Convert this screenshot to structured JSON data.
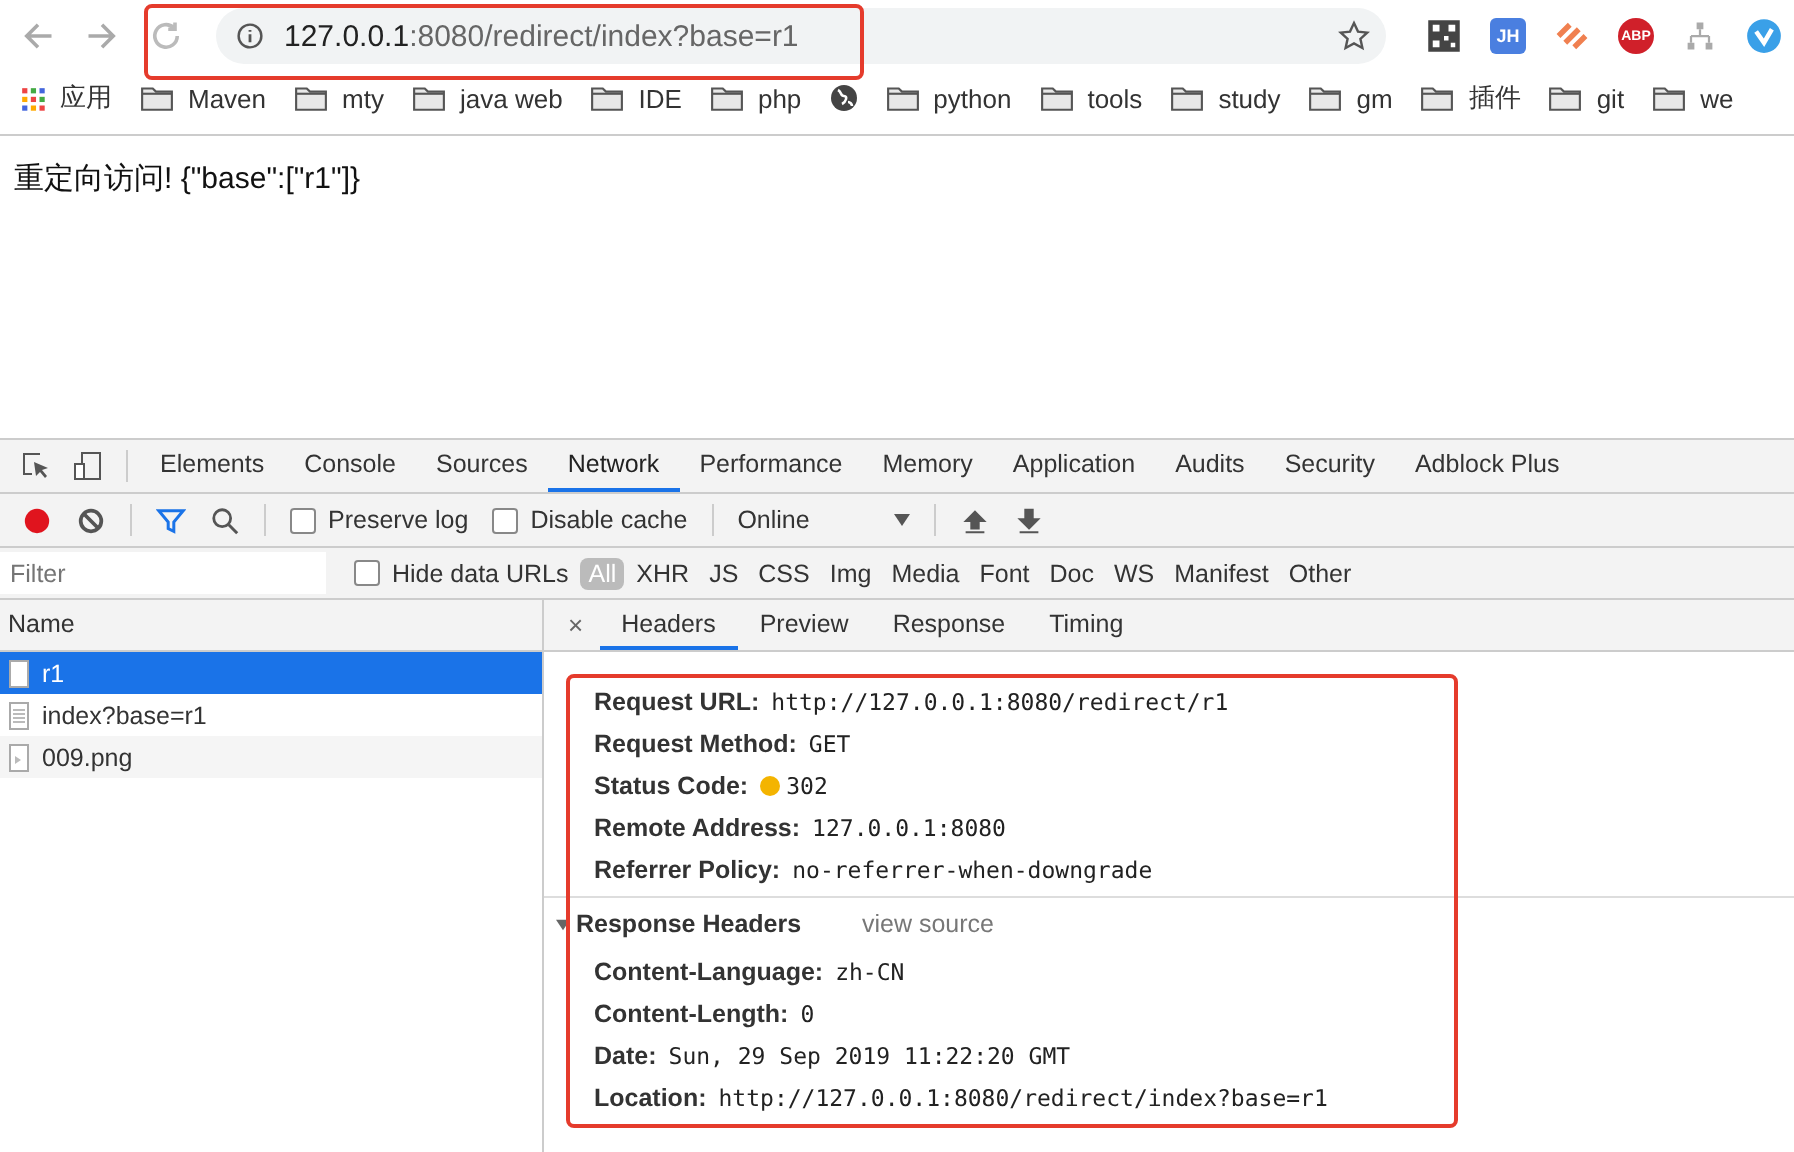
{
  "browser": {
    "url_host": "127.0.0.1",
    "url_path": ":8080/redirect/index?base=r1",
    "extensions": [
      {
        "kind": "qr"
      },
      {
        "kind": "badge",
        "label": "JH",
        "color": "#4a7fe0"
      },
      {
        "kind": "stripes"
      },
      {
        "kind": "badge",
        "label": "ABP",
        "color": "#d0202a"
      },
      {
        "kind": "tree"
      },
      {
        "kind": "check"
      }
    ],
    "bookmarks": [
      {
        "kind": "apps",
        "label": "应用"
      },
      {
        "kind": "folder",
        "label": "Maven"
      },
      {
        "kind": "folder",
        "label": "mty"
      },
      {
        "kind": "folder",
        "label": "java web"
      },
      {
        "kind": "folder",
        "label": "IDE"
      },
      {
        "kind": "folder",
        "label": "php"
      },
      {
        "kind": "globe"
      },
      {
        "kind": "folder",
        "label": "python"
      },
      {
        "kind": "folder",
        "label": "tools"
      },
      {
        "kind": "folder",
        "label": "study"
      },
      {
        "kind": "folder",
        "label": "gm"
      },
      {
        "kind": "folder",
        "label": "插件"
      },
      {
        "kind": "folder",
        "label": "git"
      },
      {
        "kind": "folder",
        "label": "we"
      }
    ]
  },
  "page": {
    "text": "重定向访问! {\"base\":[\"r1\"]}"
  },
  "devtools": {
    "tabs": [
      {
        "label": "Elements",
        "selected": false
      },
      {
        "label": "Console",
        "selected": false
      },
      {
        "label": "Sources",
        "selected": false
      },
      {
        "label": "Network",
        "selected": true
      },
      {
        "label": "Performance",
        "selected": false
      },
      {
        "label": "Memory",
        "selected": false
      },
      {
        "label": "Application",
        "selected": false
      },
      {
        "label": "Audits",
        "selected": false
      },
      {
        "label": "Security",
        "selected": false
      },
      {
        "label": "Adblock Plus",
        "selected": false
      }
    ],
    "toolbar": {
      "options": [
        {
          "label": "Preserve log",
          "checked": false
        },
        {
          "label": "Disable cache",
          "checked": false
        }
      ],
      "throttling": "Online"
    },
    "filter": {
      "placeholder": "Filter",
      "hide_data_urls": {
        "label": "Hide data URLs",
        "checked": false
      },
      "types": [
        {
          "label": "All",
          "selected": true
        },
        {
          "label": "XHR",
          "selected": false
        },
        {
          "label": "JS",
          "selected": false
        },
        {
          "label": "CSS",
          "selected": false
        },
        {
          "label": "Img",
          "selected": false
        },
        {
          "label": "Media",
          "selected": false
        },
        {
          "label": "Font",
          "selected": false
        },
        {
          "label": "Doc",
          "selected": false
        },
        {
          "label": "WS",
          "selected": false
        },
        {
          "label": "Manifest",
          "selected": false
        },
        {
          "label": "Other",
          "selected": false
        }
      ]
    },
    "requests": {
      "column": "Name",
      "rows": [
        {
          "name": "r1",
          "kind": "doc",
          "selected": true
        },
        {
          "name": "index?base=r1",
          "kind": "doc",
          "selected": false
        },
        {
          "name": "009.png",
          "kind": "image",
          "selected": false
        }
      ]
    },
    "close": "×",
    "detail_tabs": [
      {
        "label": "Headers",
        "selected": true
      },
      {
        "label": "Preview",
        "selected": false
      },
      {
        "label": "Response",
        "selected": false
      },
      {
        "label": "Timing",
        "selected": false
      }
    ],
    "general": [
      {
        "key": "Request URL:",
        "value": "http://127.0.0.1:8080/redirect/r1"
      },
      {
        "key": "Request Method:",
        "value": "GET"
      },
      {
        "key": "Status Code:",
        "value": "302",
        "kind": "status"
      },
      {
        "key": "Remote Address:",
        "value": "127.0.0.1:8080"
      },
      {
        "key": "Referrer Policy:",
        "value": "no-referrer-when-downgrade"
      }
    ],
    "response_headers": {
      "title": "Response Headers",
      "expanded": true,
      "view_source": "view source",
      "rows": [
        {
          "key": "Content-Language:",
          "value": "zh-CN"
        },
        {
          "key": "Content-Length:",
          "value": "0"
        },
        {
          "key": "Date:",
          "value": "Sun, 29 Sep 2019 11:22:20 GMT"
        },
        {
          "key": "Location:",
          "value": "http://127.0.0.1:8080/redirect/index?base=r1"
        }
      ]
    }
  }
}
